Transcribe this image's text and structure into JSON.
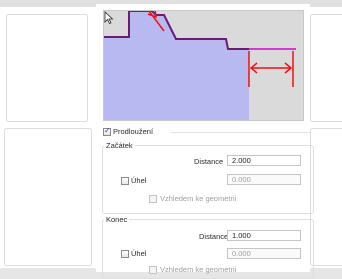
{
  "options": {
    "prodlouzeni": {
      "label": "Prodloužení",
      "checked": true
    },
    "zacatek": {
      "title": "Začátek",
      "distance_label": "Distance",
      "distance_value": "2.000",
      "uhel_label": "Úhel",
      "uhel_value": "0.000",
      "vzhledem_label": "Vzhledem ke geometrii"
    },
    "konec": {
      "title": "Konec",
      "distance_label": "Distance",
      "distance_value": "1.000",
      "uhel_label": "Úhel",
      "uhel_value": "0.000",
      "vzhledem_label": "Vzhledem ke geometrii"
    }
  },
  "colors": {
    "part_fill": "#b9b9f2",
    "profile": "#6c1a73",
    "extension": "#d33ad3",
    "dimension": "#ee1111"
  }
}
